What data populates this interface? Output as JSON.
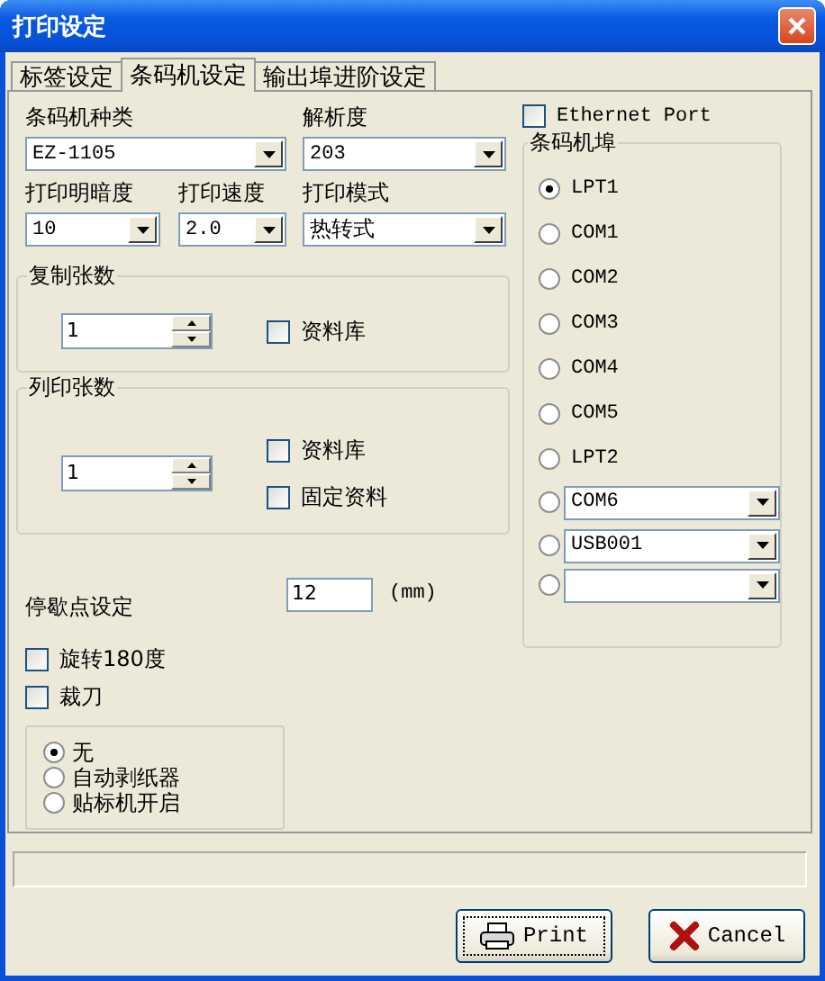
{
  "window": {
    "title": "打印设定"
  },
  "tabs": [
    {
      "label": "标签设定",
      "selected": false
    },
    {
      "label": "条码机设定",
      "selected": true
    },
    {
      "label": "输出埠进阶设定",
      "selected": false
    }
  ],
  "printer_type": {
    "label": "条码机种类",
    "value": "EZ-1105"
  },
  "resolution": {
    "label": "解析度",
    "value": "203"
  },
  "darkness": {
    "label": "打印明暗度",
    "value": "10"
  },
  "speed": {
    "label": "打印速度",
    "value": "2.0"
  },
  "mode": {
    "label": "打印模式",
    "value": "热转式"
  },
  "copies": {
    "title": "复制张数",
    "value": "1",
    "options": [
      {
        "label": "资料库",
        "checked": false
      }
    ]
  },
  "print_count": {
    "title": "列印张数",
    "value": "1",
    "options": [
      {
        "label": "资料库",
        "checked": false
      },
      {
        "label": "固定资料",
        "checked": false
      }
    ]
  },
  "stop_point": {
    "label": "停歇点设定",
    "value": "12",
    "unit": "(mm)"
  },
  "options": [
    {
      "label": "旋转180度",
      "checked": false
    },
    {
      "label": "裁刀",
      "checked": false
    }
  ],
  "output_mode": [
    {
      "label": "无",
      "selected": true
    },
    {
      "label": "自动剥纸器",
      "selected": false
    },
    {
      "label": "贴标机开启",
      "selected": false
    }
  ],
  "ethernet_port": {
    "label": "Ethernet Port",
    "checked": false
  },
  "ports": {
    "title": "条码机埠",
    "items": [
      {
        "kind": "radio",
        "label": "LPT1",
        "selected": true
      },
      {
        "kind": "radio",
        "label": "COM1",
        "selected": false
      },
      {
        "kind": "radio",
        "label": "COM2",
        "selected": false
      },
      {
        "kind": "radio",
        "label": "COM3",
        "selected": false
      },
      {
        "kind": "radio",
        "label": "COM4",
        "selected": false
      },
      {
        "kind": "radio",
        "label": "COM5",
        "selected": false
      },
      {
        "kind": "radio",
        "label": "LPT2",
        "selected": false
      },
      {
        "kind": "combo",
        "value": "COM6",
        "selected": false
      },
      {
        "kind": "combo",
        "value": "USB001",
        "selected": false
      },
      {
        "kind": "combo",
        "selected": false
      }
    ]
  },
  "buttons": [
    {
      "kind": "print",
      "label": "Print",
      "focused": true
    },
    {
      "kind": "cancel",
      "label": "Cancel",
      "focused": false
    }
  ]
}
